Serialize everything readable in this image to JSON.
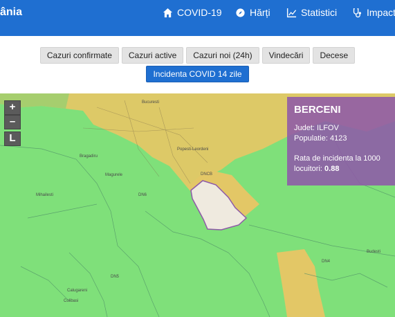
{
  "header": {
    "brand": "ânia",
    "nav": [
      {
        "label": "COVID-19",
        "icon": "home-icon"
      },
      {
        "label": "Hărți",
        "icon": "compass-icon"
      },
      {
        "label": "Statistici",
        "icon": "chart-icon"
      },
      {
        "label": "Impact",
        "icon": "stethoscope-icon"
      }
    ]
  },
  "toolbar": {
    "buttons": [
      "Cazuri confirmate",
      "Cazuri active",
      "Cazuri noi (24h)",
      "Vindecări",
      "Decese"
    ],
    "active_button": "Incidenta COVID 14 zile"
  },
  "map": {
    "zoom_in": "+",
    "zoom_out": "–",
    "layers": "L",
    "place_labels": [
      "Bucuresti",
      "Popesti-Leordeni",
      "Bragadiru",
      "Magurele",
      "Mihailesti",
      "Budesti",
      "Calugareni",
      "Colibasi",
      "DN5",
      "DN6",
      "DN4",
      "DNCB"
    ]
  },
  "info_panel": {
    "title": "BERCENI",
    "county_line": "Judet: ILFOV",
    "population_line": "Populatie: 4123",
    "rate_label": "Rata de incidenta la 1000 locuitori:",
    "rate_value": "0.88"
  },
  "colors": {
    "navbar": "#1f6fd1",
    "active_button": "#1f6fd1",
    "map_low": "#7fe07a",
    "map_high": "#e3c766",
    "selected_region": "#efeadf",
    "info_panel": "#8e59a8"
  }
}
